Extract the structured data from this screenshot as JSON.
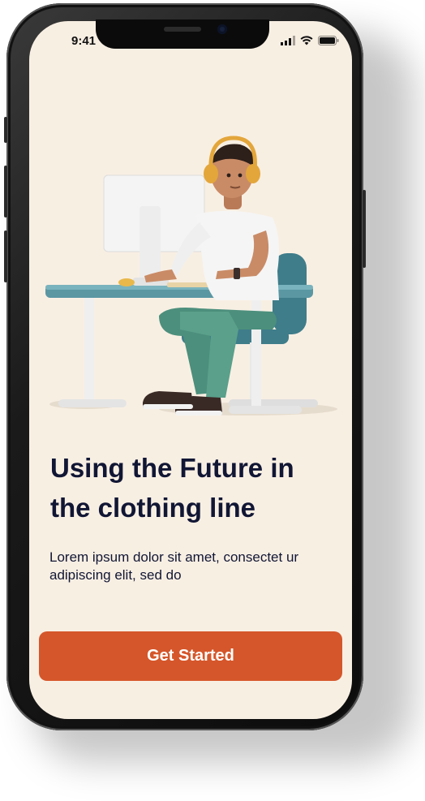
{
  "status_bar": {
    "time": "9:41",
    "icons": [
      "signal-icon",
      "wifi-icon",
      "battery-icon"
    ]
  },
  "onboarding": {
    "illustration": "person-at-desk-illustration",
    "title": "Using the Future in the clothing line",
    "description": "Lorem ipsum dolor sit amet, consectet ur adipiscing elit, sed do",
    "cta_label": "Get Started"
  },
  "colors": {
    "background": "#f8efe3",
    "title_text": "#111634",
    "accent": "#d5562a",
    "device_frame": "#0c0c0c"
  }
}
